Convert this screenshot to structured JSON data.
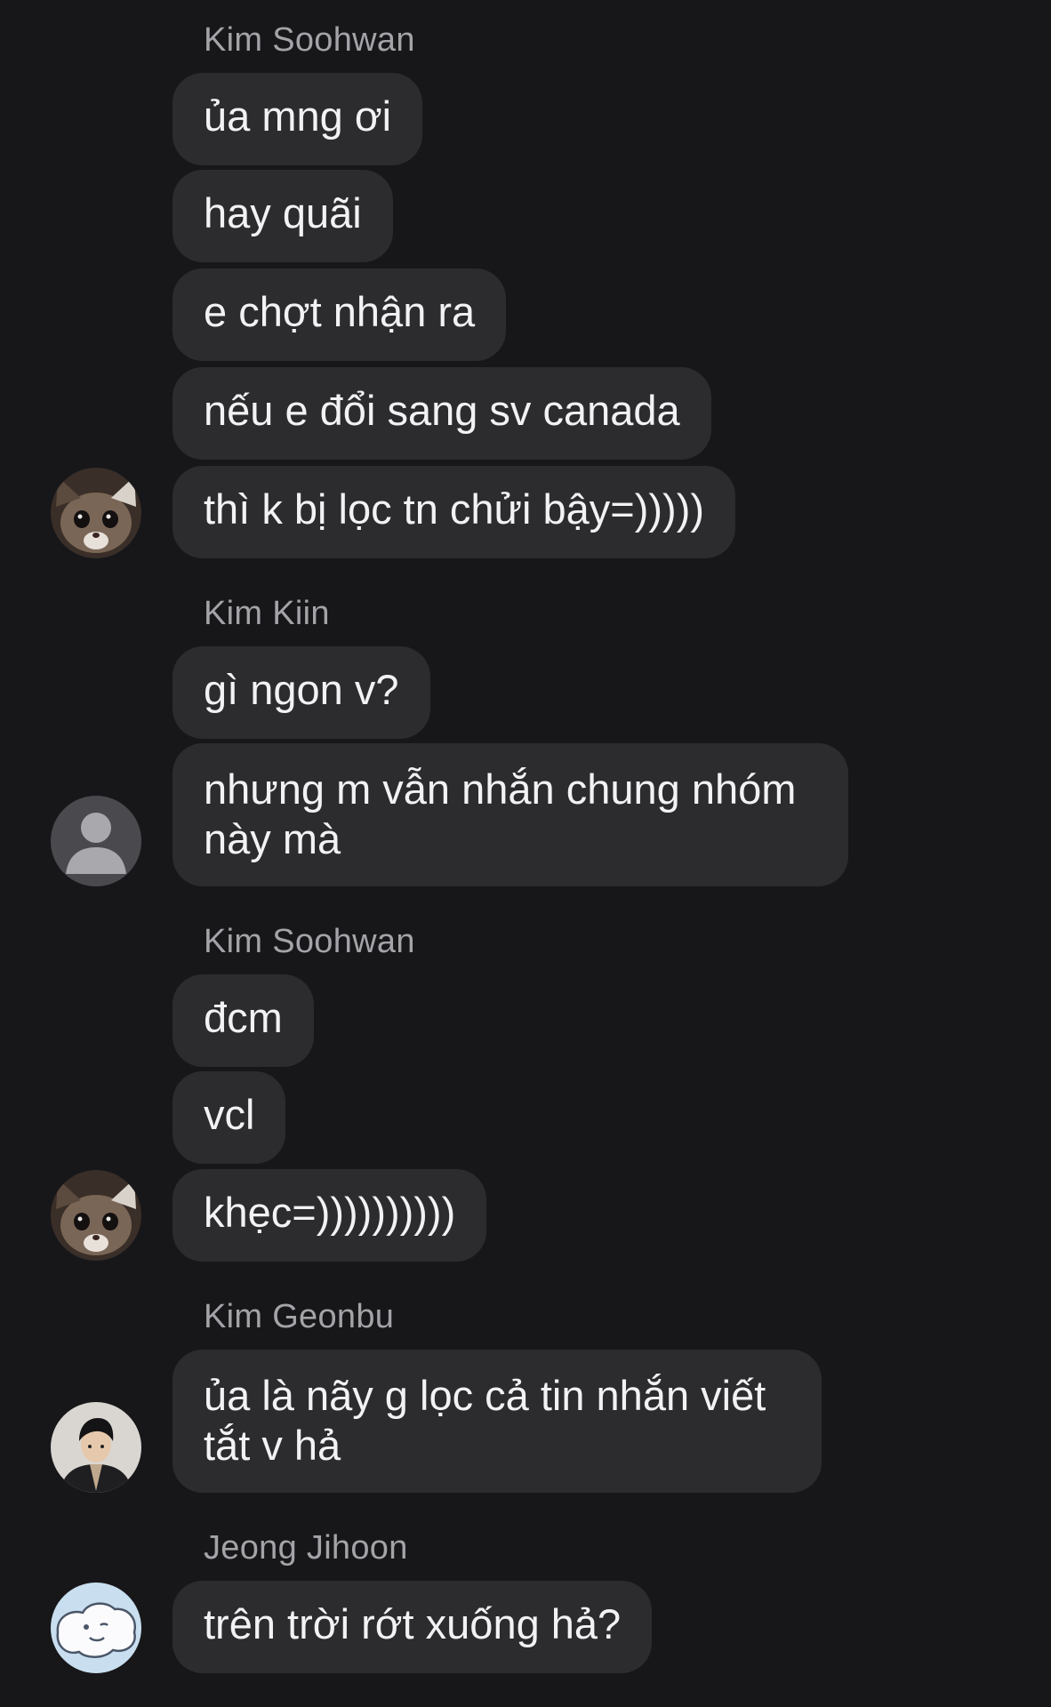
{
  "groups": [
    {
      "sender": "Kim Soohwan",
      "avatar_icon": "cat-avatar-icon",
      "messages": [
        "ủa mng ơi",
        "hay quãi",
        "e chợt nhận ra",
        "nếu e đổi sang sv canada",
        "thì k bị lọc tn chửi bậy=)))))"
      ]
    },
    {
      "sender": "Kim Kiin",
      "avatar_icon": "default-person-avatar-icon",
      "messages": [
        "gì ngon v?",
        "nhưng m vẫn nhắn chung nhóm này mà"
      ]
    },
    {
      "sender": "Kim Soohwan",
      "avatar_icon": "cat-avatar-icon",
      "messages": [
        "đcm",
        "vcl",
        "khẹc=))))))))))"
      ]
    },
    {
      "sender": "Kim Geonbu",
      "avatar_icon": "person-photo-avatar-icon",
      "messages": [
        "ủa là nãy g lọc cả tin nhắn viết tắt v hả"
      ]
    },
    {
      "sender": "Jeong Jihoon",
      "avatar_icon": "cloud-drawing-avatar-icon",
      "messages": [
        "trên trời rớt xuống hả?"
      ]
    }
  ],
  "colors": {
    "background": "#17171a",
    "bubble": "#2c2c2e",
    "bubble_text": "#f2f2f4",
    "sender_text": "#a3a3a8"
  }
}
